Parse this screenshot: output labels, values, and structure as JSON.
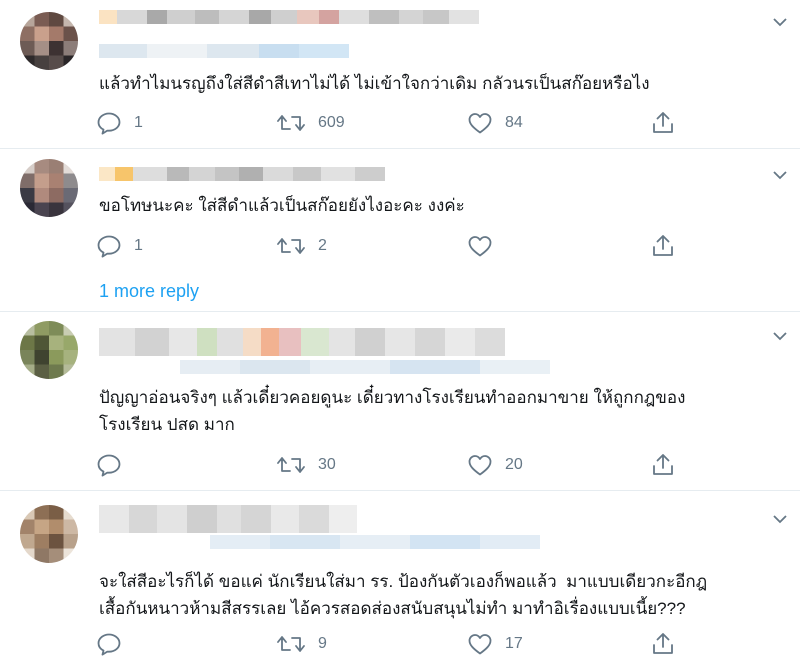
{
  "colors": {
    "accent": "#1da1f2",
    "text": "#14171a",
    "muted": "#657786",
    "divider": "#e6ecf0"
  },
  "icons": {
    "reply": "reply-icon",
    "retweet": "retweet-icon",
    "like": "heart-icon",
    "share": "share-icon",
    "menu": "chevron-down-icon"
  },
  "tweets": [
    {
      "text": "แล้วทำไมนรญถึงใส่สีดำสีเทาไม่ได้ ไม่เข้าใจกว่าเดิม กลัวนรเป็นสก๊อยหรือไง",
      "replies": "1",
      "retweets": "609",
      "likes": "84"
    },
    {
      "text": "ขอโทษนะคะ ใส่สีดำแล้วเป็นสก๊อยยังไงอะคะ งงค่ะ",
      "replies": "1",
      "retweets": "2",
      "likes": "",
      "more_reply": "1 more reply"
    },
    {
      "text": "ปัญญาอ่อนจริงๆ แล้วเดี๋ยวคอยดูนะ เดี๋ยวทางโรงเรียนทำออกมาขาย ให้ถูกกฎของ\nโรงเรียน ปสด มาก",
      "replies": "",
      "retweets": "30",
      "likes": "20"
    },
    {
      "text": "จะใส่สีอะไรก็ได้ ขอแค่ นักเรียนใส่มา รร. ป้องกันตัวเองก็พอแล้ว  มาแบบเดียวกะอีกฎ\nเสื้อกันหนาวห้ามสีสรรเลย ไอ้ควรสอดส่องสนับสนุนไม่ทำ มาทำอิเรื่องแบบเนี้ย???",
      "replies": "",
      "retweets": "9",
      "likes": "17"
    }
  ]
}
